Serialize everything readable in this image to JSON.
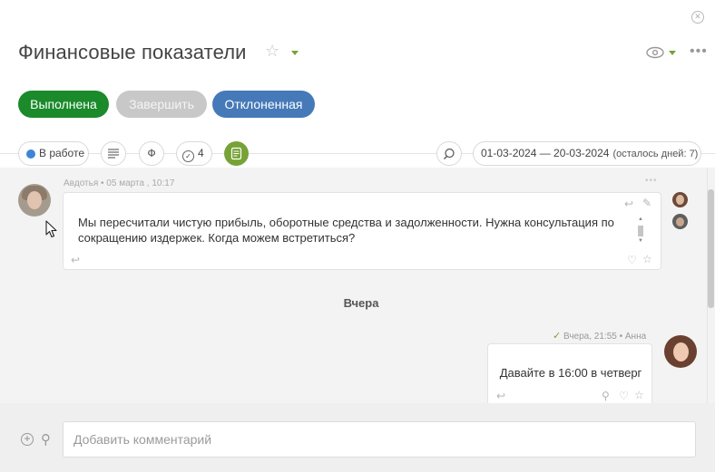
{
  "header": {
    "title": "Финансовые показатели",
    "close_glyph": "✕",
    "star_glyph": "☆",
    "more_glyph": "•••"
  },
  "status_buttons": {
    "done": "Выполнена",
    "finish": "Завершить",
    "rejected": "Отклоненная"
  },
  "toolbar": {
    "status_label": "В работе",
    "status_color": "#3d85d8",
    "fin_glyph": "Ф",
    "checklist_count": "4",
    "dates": "01-03-2024 — 20-03-2024",
    "remaining": "(осталось дней: 7)"
  },
  "feed": {
    "message1": {
      "author_meta": "Авдотья • 05 марта , 10:17",
      "text": "Мы пересчитали чистую прибыль, оборотные средства и задолженности. Нужна консультация по сокращению издержек. Когда можем встретиться?"
    },
    "day_divider": "Вчера",
    "message2": {
      "meta": "Вчера, 21:55 • Анна",
      "tick": "✓",
      "text": "Давайте в 16:00 в четверг"
    }
  },
  "footer": {
    "placeholder": "Добавить комментарий"
  },
  "colors": {
    "accent_green": "#77a237",
    "done_green": "#1a8a2b",
    "rejected_blue": "#4679b8"
  }
}
